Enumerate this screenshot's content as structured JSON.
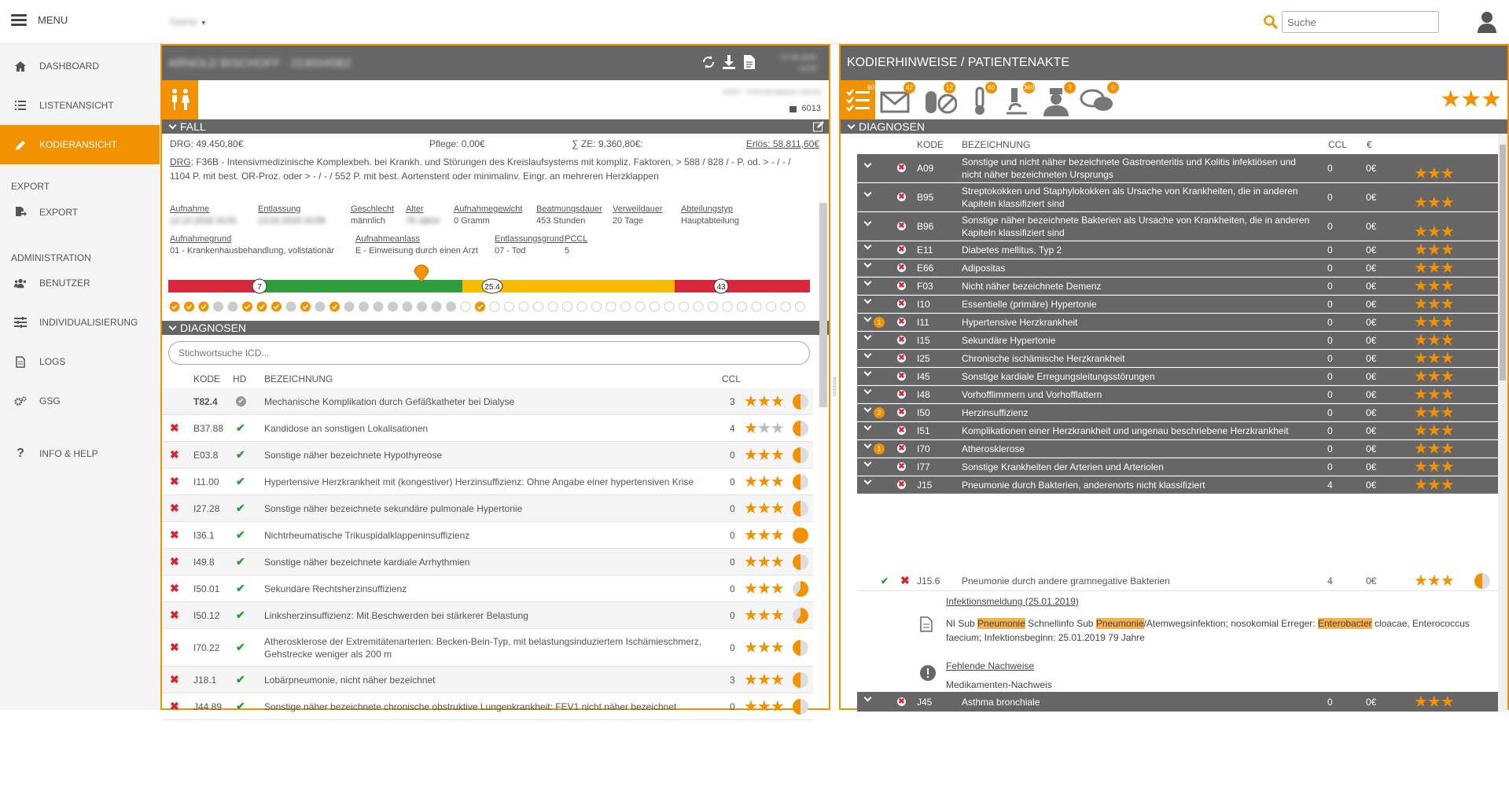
{
  "topbar": {
    "menu_label": "MENU",
    "selector_value": "Name",
    "search_placeholder": "Suche"
  },
  "sidebar": {
    "items": [
      {
        "label": "DASHBOARD",
        "icon": "home-icon"
      },
      {
        "label": "LISTENANSICHT",
        "icon": "list-icon"
      },
      {
        "label": "KODIERANSICHT",
        "icon": "pencil-icon",
        "active": true
      },
      {
        "label": "EXPORT",
        "icon": "export-icon"
      },
      {
        "label": "BENUTZER",
        "icon": "users-icon"
      },
      {
        "label": "INDIVIDUALISIERUNG",
        "icon": "sliders-icon"
      },
      {
        "label": "LOGS",
        "icon": "document-icon"
      },
      {
        "label": "GSG",
        "icon": "gears-icon"
      },
      {
        "label": "INFO & HELP",
        "icon": "question-icon"
      }
    ],
    "sections": {
      "export": "EXPORT",
      "administration": "ADMINISTRATION"
    }
  },
  "left": {
    "header": {
      "patient": "ARNOLD BISCHOFF · 2190045B2",
      "date": "07.06.2020",
      "time": "14:09"
    },
    "station": "AOH - Intensivstation Herne",
    "case_count": "6013",
    "fall": {
      "section_title": "FALL",
      "drg_amount": "DRG: 49.450,80€",
      "pflege": "Pflege: 0,00€",
      "ze": "∑ ZE: 9.360,80€:",
      "erloes": "Erlös: 58.811,60€",
      "drg_label": "DRG",
      "drg_text": ": F36B - Intensivmedizinische Komplexbeh. bei Krankh. und Störungen des Kreislaufsystems mit kompliz. Faktoren, > 588 / 828 / - P. od. > - / - / 1104 P. mit best. OR-Proz. oder > - / - / 552 P. mit best. Aortenstent oder minimalinv. Eingr. an mehreren Herzklappen",
      "fields1": [
        {
          "label": "Aufnahme",
          "value": "12.12.2018 10:51"
        },
        {
          "label": "Entlassung",
          "value": "13.02.2019 10:58"
        },
        {
          "label": "Geschlecht",
          "value": "männlich"
        },
        {
          "label": "Alter",
          "value": "78 Jahre"
        },
        {
          "label": "Aufnahmegewicht",
          "value": "0 Gramm"
        },
        {
          "label": "Beatmungsdauer",
          "value": "453 Stunden"
        },
        {
          "label": "Verweildauer",
          "value": "20 Tage"
        },
        {
          "label": "Abteilungstyp",
          "value": "Hauptabteilung"
        }
      ],
      "fields2": [
        {
          "label": "Aufnahmegrund",
          "value": "01 - Krankenhausbehandlung, vollstationär"
        },
        {
          "label": "Aufnahmeanlass",
          "value": "E - Einweisung durch einen Arzt"
        },
        {
          "label": "Entlassungsgrund",
          "value": "07 - Tod"
        },
        {
          "label": "PCCL",
          "value": "5"
        }
      ],
      "timeline": {
        "low": "7",
        "mid": "25.4",
        "high": "43"
      }
    },
    "diagnosen": {
      "section_title": "DIAGNOSEN",
      "search_placeholder": "Stichwortsuche ICD...",
      "headers": {
        "code": "KODE",
        "hd": "HD",
        "desc": "BEZEICHNUNG",
        "ccl": "CCL"
      },
      "rows": [
        {
          "code": "T82.4",
          "desc": "Mechanische Komplikation durch Gefäßkatheter bei Dialyse",
          "ccl": "3"
        },
        {
          "code": "B37.88",
          "desc": "Kandidose an sonstigen Lokalisationen",
          "ccl": "4"
        },
        {
          "code": "E03.8",
          "desc": "Sonstige näher bezeichnete Hypothyreose",
          "ccl": "0"
        },
        {
          "code": "I11.00",
          "desc": "Hypertensive Herzkrankheit mit (kongestiver) Herzinsuffizienz: Ohne Angabe einer hypertensiven Krise",
          "ccl": "0"
        },
        {
          "code": "I27.28",
          "desc": "Sonstige näher bezeichnete sekundäre pulmonale Hypertonie",
          "ccl": "0"
        },
        {
          "code": "I36.1",
          "desc": "Nichtrheumatische Trikuspidalklappeninsuffizienz",
          "ccl": "0"
        },
        {
          "code": "I49.8",
          "desc": "Sonstige näher bezeichnete kardiale Arrhythmien",
          "ccl": "0"
        },
        {
          "code": "I50.01",
          "desc": "Sekundäre Rechtsherzinsuffizienz",
          "ccl": "0"
        },
        {
          "code": "I50.12",
          "desc": "Linksherzinsuffizienz: Mit Beschwerden bei stärkerer Belastung",
          "ccl": "0"
        },
        {
          "code": "I70.22",
          "desc": "Atherosklerose der Extremitätenarterien: Becken-Bein-Typ, mit belastungsinduziertem Ischämieschmerz, Gehstrecke weniger als 200 m",
          "ccl": "0"
        },
        {
          "code": "J18.1",
          "desc": "Lobärpneumonie, nicht näher bezeichnet",
          "ccl": "3"
        },
        {
          "code": "J44.89",
          "desc": "Sonstige näher bezeichnete chronische obstruktive Lungenkrankheit: FEV1 nicht näher bezeichnet",
          "ccl": "0"
        }
      ]
    }
  },
  "right": {
    "title": "KODIERHINWEISE / PATIENTENAKTE",
    "categories": [
      {
        "icon": "checklist-icon",
        "count": "80"
      },
      {
        "icon": "envelope-icon",
        "count": "42"
      },
      {
        "icon": "pills-icon",
        "count": "12"
      },
      {
        "icon": "thermometer-icon",
        "count": "40"
      },
      {
        "icon": "microscope-icon",
        "count": "369"
      },
      {
        "icon": "nurse-icon",
        "count": "3"
      },
      {
        "icon": "chat-icon",
        "count": "0"
      }
    ],
    "diagnosen": {
      "section_title": "DIAGNOSEN",
      "headers": {
        "code": "KODE",
        "desc": "BEZEICHNUNG",
        "ccl": "CCL",
        "euro": "€"
      },
      "rows": [
        {
          "code": "A09",
          "desc": "Sonstige und nicht näher bezeichnete Gastroenteritis und Kolitis infektiösen und nicht näher bezeichneten Ursprungs",
          "ccl": "0",
          "euro": "0€",
          "badge": ""
        },
        {
          "code": "B95",
          "desc": "Streptokokken und Staphylokokken als Ursache von Krankheiten, die in anderen Kapiteln klassifiziert sind",
          "ccl": "0",
          "euro": "0€",
          "badge": ""
        },
        {
          "code": "B96",
          "desc": "Sonstige näher bezeichnete Bakterien als Ursache von Krankheiten, die in anderen Kapiteln klassifiziert sind",
          "ccl": "0",
          "euro": "0€",
          "badge": ""
        },
        {
          "code": "E11",
          "desc": "Diabetes mellitus, Typ 2",
          "ccl": "0",
          "euro": "0€",
          "badge": ""
        },
        {
          "code": "E66",
          "desc": "Adipositas",
          "ccl": "0",
          "euro": "0€",
          "badge": ""
        },
        {
          "code": "F03",
          "desc": "Nicht näher bezeichnete Demenz",
          "ccl": "0",
          "euro": "0€",
          "badge": ""
        },
        {
          "code": "I10",
          "desc": "Essentielle (primäre) Hypertonie",
          "ccl": "0",
          "euro": "0€",
          "badge": ""
        },
        {
          "code": "I11",
          "desc": "Hypertensive Herzkrankheit",
          "ccl": "0",
          "euro": "0€",
          "badge": "1"
        },
        {
          "code": "I15",
          "desc": "Sekundäre Hypertonie",
          "ccl": "0",
          "euro": "0€",
          "badge": ""
        },
        {
          "code": "I25",
          "desc": "Chronische ischämische Herzkrankheit",
          "ccl": "0",
          "euro": "0€",
          "badge": ""
        },
        {
          "code": "I45",
          "desc": "Sonstige kardiale Erregungsleitungsstörungen",
          "ccl": "0",
          "euro": "0€",
          "badge": ""
        },
        {
          "code": "I48",
          "desc": "Vorhofflimmern und Vorhofflattern",
          "ccl": "0",
          "euro": "0€",
          "badge": ""
        },
        {
          "code": "I50",
          "desc": "Herzinsuffizienz",
          "ccl": "0",
          "euro": "0€",
          "badge": "2"
        },
        {
          "code": "I51",
          "desc": "Komplikationen einer Herzkrankheit und ungenau beschriebene Herzkrankheit",
          "ccl": "0",
          "euro": "0€",
          "badge": ""
        },
        {
          "code": "I70",
          "desc": "Atherosklerose",
          "ccl": "0",
          "euro": "0€",
          "badge": "1"
        },
        {
          "code": "I77",
          "desc": "Sonstige Krankheiten der Arterien und Arteriolen",
          "ccl": "0",
          "euro": "0€",
          "badge": ""
        },
        {
          "code": "J15",
          "desc": "Pneumonie durch Bakterien, anderenorts nicht klassifiziert",
          "ccl": "4",
          "euro": "0€",
          "badge": ""
        }
      ],
      "sub": {
        "code": "J15.6",
        "desc": "Pneumonie durch andere gramnegative Bakterien",
        "ccl": "4",
        "euro": "0€"
      },
      "note": {
        "title": "Infektionsmeldung (25.01.2019)",
        "t1": "NI Sub ",
        "h1": "Pneumonie",
        "t2": " Schnellinfo Sub ",
        "h2": "Pneumonie",
        "t3": "/Atemwegsinfektion; nosokomial Erreger: ",
        "h3": "Enterobacter",
        "t4": " cloacae, Enterococcus faecium; Infektionsbeginn: 25.01.2019 79 Jahre",
        "missing_title": "Fehlende Nachweise",
        "missing_item": "Medikamenten-Nachweis"
      },
      "last": {
        "code": "J45",
        "desc": "Asthma bronchiale",
        "ccl": "0",
        "euro": "0€"
      }
    }
  },
  "colors": {
    "accent": "#f39200",
    "header_gray": "#666666",
    "red": "#d9232d",
    "green": "#2a9d2f",
    "timeline_red": "#d9283b",
    "timeline_green": "#2e9e3c",
    "timeline_yellow": "#f7bd00"
  }
}
